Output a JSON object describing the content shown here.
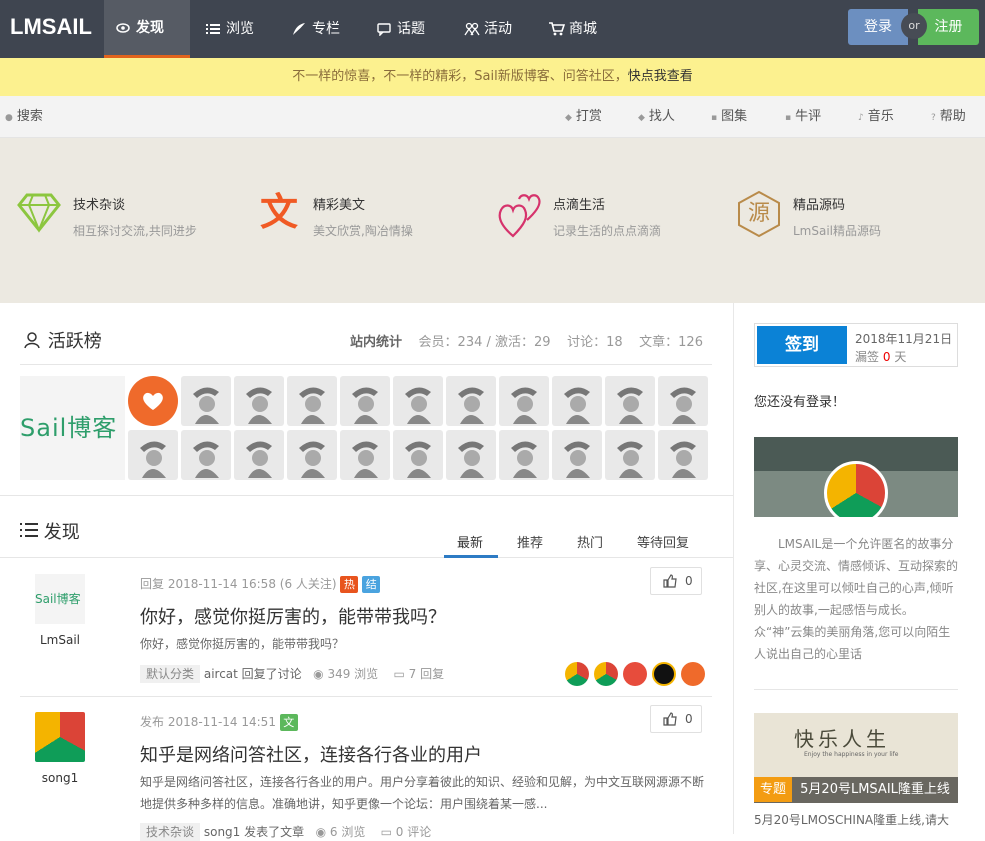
{
  "nav": {
    "logo": "LMSAIL",
    "items": [
      {
        "label": "发现",
        "icon": "eye-icon"
      },
      {
        "label": "浏览",
        "icon": "list-icon"
      },
      {
        "label": "专栏",
        "icon": "quill-icon"
      },
      {
        "label": "话题",
        "icon": "comment-icon"
      },
      {
        "label": "活动",
        "icon": "people-icon"
      },
      {
        "label": "商城",
        "icon": "cart-icon"
      }
    ],
    "login": "登录",
    "or": "or",
    "register": "注册"
  },
  "notice": {
    "text": "不一样的惊喜，不一样的精彩，Sail新版博客、问答社区，",
    "link": "快点我查看"
  },
  "subbar": {
    "search": "搜索",
    "links": [
      "打赏",
      "找人",
      "图集",
      "牛评",
      "音乐",
      "帮助"
    ]
  },
  "features": [
    {
      "title": "技术杂谈",
      "desc": "相互探讨交流,共同进步",
      "icon": "diamond-icon",
      "color": "#8cc63f"
    },
    {
      "title": "精彩美文",
      "desc": "美文欣赏,陶冶情操",
      "icon": "wen-icon",
      "glyph": "文",
      "color": "#f05a24"
    },
    {
      "title": "点滴生活",
      "desc": "记录生活的点点滴滴",
      "icon": "hearts-icon",
      "color": "#d6336c"
    },
    {
      "title": "精品源码",
      "desc": "LmSail精品源码",
      "icon": "yuan-icon",
      "glyph": "源",
      "color": "#b98b4a"
    }
  ],
  "active": {
    "title": "活跃榜",
    "stats_label": "站内统计",
    "members": "会员：234 / 激活：29",
    "discuss": "讨论：18",
    "articles": "文章：126",
    "big_avatar_text": "Sail博客"
  },
  "discover": {
    "title": "发现",
    "tabs": [
      "最新",
      "推荐",
      "热门",
      "等待回复"
    ]
  },
  "posts": [
    {
      "user": "LmSail",
      "meta": "回复 2018-11-14 16:58 (6 人关注)",
      "tags": [
        {
          "t": "热",
          "c": "#e8541e"
        },
        {
          "t": "结",
          "c": "#4aa3df"
        }
      ],
      "title": "你好，感觉你挺厉害的，能带带我吗？",
      "excerpt": "你好，感觉你挺厉害的，能带带我吗？",
      "cat": "默认分类",
      "action": "aircat 回复了讨论",
      "views": "349 浏览",
      "replies": "7 回复",
      "likes": "0"
    },
    {
      "user": "song1",
      "meta": "发布 2018-11-14 14:51",
      "tags": [
        {
          "t": "文",
          "c": "#5cb85c"
        }
      ],
      "title": "知乎是网络问答社区，连接各行各业的用户",
      "excerpt": "知乎是网络问答社区，连接各行各业的用户。用户分享着彼此的知识、经验和见解，为中文互联网源源不断地提供多种多样的信息。准确地讲，知乎更像一个论坛：用户围绕着某一感...",
      "cat": "技术杂谈",
      "action": "song1 发表了文章",
      "views": "6 浏览",
      "replies": "0 评论",
      "likes": "0"
    }
  ],
  "sidebar": {
    "sign": "签到",
    "date": "2018年11月21日",
    "missed_prefix": "漏签",
    "missed_count": "0",
    "missed_suffix": "天",
    "nologin": "您还没有登录！",
    "intro": "LMSAIL是一个允许匿名的故事分享、心灵交流、情感倾诉、互动探索的社区,在这里可以倾吐自己的心声,倾听别人的故事,一起感悟与成长。众“神”云集的美丽角落,您可以向陌生人说出自己的心里话",
    "banner_tag": "专题",
    "banner_title": "5月20号LMSAIL隆重上线",
    "banner_art": "快乐人生",
    "banner_sub": "Enjoy the happiness in your life",
    "next_text": "5月20号LMOSCHINA隆重上线,请大"
  }
}
